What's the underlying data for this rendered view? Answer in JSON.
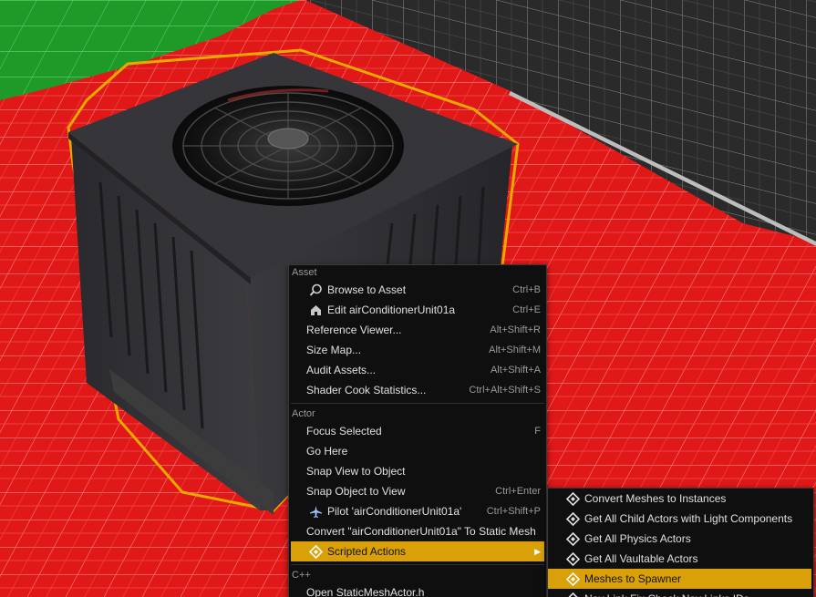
{
  "colors": {
    "highlight": "#d9a007",
    "menu_bg": "#0f0f0f",
    "floor_red": "#e01818",
    "floor_green": "#1e9a28",
    "wall_gray": "#2b2b2b",
    "selection_outline": "#e8a800"
  },
  "main_menu": {
    "asset_header": "Asset",
    "asset_items": [
      {
        "label": "Browse to Asset",
        "shortcut": "Ctrl+B",
        "icon": "magnifier-browse-icon"
      },
      {
        "label": "Edit airConditionerUnit01a",
        "shortcut": "Ctrl+E",
        "icon": "edit-house-icon"
      },
      {
        "label": "Reference Viewer...",
        "shortcut": "Alt+Shift+R"
      },
      {
        "label": "Size Map...",
        "shortcut": "Alt+Shift+M"
      },
      {
        "label": "Audit Assets...",
        "shortcut": "Alt+Shift+A"
      },
      {
        "label": "Shader Cook Statistics...",
        "shortcut": "Ctrl+Alt+Shift+S"
      }
    ],
    "actor_header": "Actor",
    "actor_items": [
      {
        "label": "Focus Selected",
        "shortcut": "F"
      },
      {
        "label": "Go Here",
        "shortcut": ""
      },
      {
        "label": "Snap View to Object",
        "shortcut": ""
      },
      {
        "label": "Snap Object to View",
        "shortcut": "Ctrl+Enter"
      },
      {
        "label": "Pilot 'airConditionerUnit01a'",
        "shortcut": "Ctrl+Shift+P",
        "icon": "airplane-pilot-icon"
      },
      {
        "label": "Convert \"airConditionerUnit01a\" To Static Mesh",
        "shortcut": ""
      },
      {
        "label": "Scripted Actions",
        "shortcut": "",
        "icon": "diamond-script-icon",
        "submenu": true
      }
    ],
    "cpp_header": "C++",
    "cpp_items": [
      {
        "label": "Open StaticMeshActor.h",
        "shortcut": ""
      }
    ]
  },
  "sub_menu": {
    "items": [
      {
        "label": "Convert Meshes to Instances",
        "icon": "diamond-script-icon"
      },
      {
        "label": "Get All Child Actors with Light Components",
        "icon": "diamond-script-icon"
      },
      {
        "label": "Get All Physics Actors",
        "icon": "diamond-script-icon"
      },
      {
        "label": "Get All Vaultable Actors",
        "icon": "diamond-script-icon"
      },
      {
        "label": "Meshes to Spawner",
        "icon": "diamond-script-icon"
      },
      {
        "label": "Nav Link Fix Check Nav Links IDs",
        "icon": "diamond-script-icon"
      }
    ]
  }
}
